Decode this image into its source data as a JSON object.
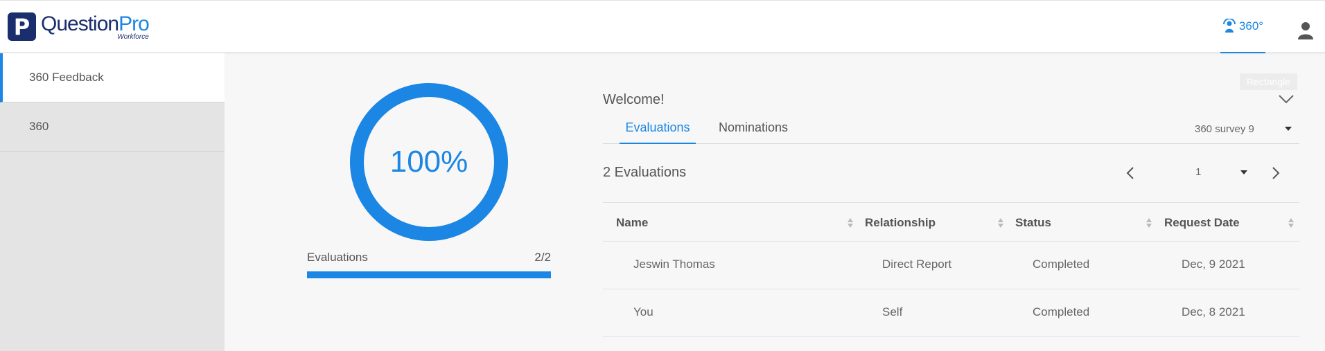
{
  "header": {
    "logo_question": "Question",
    "logo_pro": "Pro",
    "logo_sub": "Workforce",
    "nav_360_label": "360°"
  },
  "sidebar": {
    "items": [
      {
        "label": "360 Feedback",
        "active": true
      },
      {
        "label": "360",
        "active": false
      }
    ]
  },
  "progress": {
    "percent_text": "100%",
    "percent_value": 100,
    "label": "Evaluations",
    "count": "2/2",
    "fraction": 1.0
  },
  "main": {
    "tooltip": "Rectangle",
    "welcome": "Welcome!",
    "tabs": [
      {
        "label": "Evaluations",
        "active": true
      },
      {
        "label": "Nominations",
        "active": false
      }
    ],
    "survey_select": "360 survey 9",
    "eval_count": "2 Evaluations",
    "page_number": "1"
  },
  "table": {
    "headers": [
      "Name",
      "Relationship",
      "Status",
      "Request Date"
    ],
    "rows": [
      {
        "name": "Jeswin Thomas",
        "relationship": "Direct Report",
        "status": "Completed",
        "date": "Dec, 9 2021"
      },
      {
        "name": "You",
        "relationship": "Self",
        "status": "Completed",
        "date": "Dec, 8 2021"
      }
    ]
  },
  "colors": {
    "accent": "#1b86e3",
    "brand_dark": "#1a2e6e"
  },
  "icons": [
    "360-feedback-icon",
    "user-icon",
    "chevron-down-icon",
    "chevron-left-icon",
    "chevron-right-icon",
    "sort-icon",
    "caret-down-icon"
  ]
}
